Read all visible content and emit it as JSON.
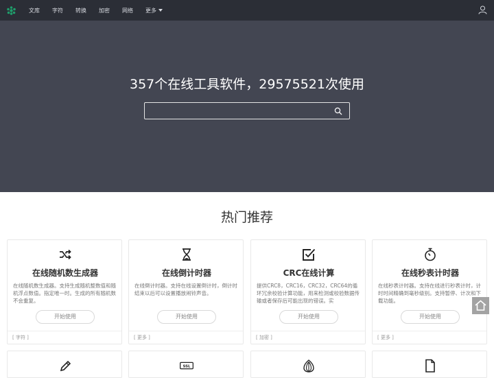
{
  "nav": {
    "items": [
      {
        "label": "文库"
      },
      {
        "label": "字符"
      },
      {
        "label": "转换"
      },
      {
        "label": "加密"
      },
      {
        "label": "网络"
      },
      {
        "label": "更多"
      }
    ]
  },
  "hero": {
    "title": "357个在线工具软件，29575521次使用",
    "search": {
      "value": "",
      "placeholder": ""
    }
  },
  "section": {
    "title": "热门推荐"
  },
  "cards": [
    {
      "icon": "shuffle-icon",
      "title": "在线随机数生成器",
      "desc": "在线随机数生成器。支持生成随机整数值和随机浮点数值。指定唯一时。生成的所有随机数不会重复。",
      "button": "开始使用",
      "tag": "[ 字符 ]"
    },
    {
      "icon": "hourglass-icon",
      "title": "在线倒计时器",
      "desc": "在线倒计时器。支持在线设置倒计时，倒计时结束以后可以设置播放闹铃声音。",
      "button": "开始使用",
      "tag": "[ 更多 ]"
    },
    {
      "icon": "checkbox-icon",
      "title": "CRC在线计算",
      "desc": "提供CRC8，CRC16，CRC32，CRC64的循环冗余校验计算功能，用来检测或校验数据传输或者保存后可能出现的错误。实",
      "button": "开始使用",
      "tag": "[ 加密 ]"
    },
    {
      "icon": "stopwatch-icon",
      "title": "在线秒表计时器",
      "desc": "在线秒表计时器。支持在线进行秒表计时，计时时间精确到毫秒级别。支持暂停、计次和下载功能。",
      "button": "开始使用",
      "tag": "[ 更多 ]"
    }
  ],
  "cards_row2": [
    {
      "icon": "pen-icon"
    },
    {
      "icon": "ssl-icon",
      "label": "SSL"
    },
    {
      "icon": "onion-icon"
    },
    {
      "icon": "document-icon"
    }
  ],
  "colors": {
    "nav_bg": "#2b2e36",
    "hero_bg": "#434652",
    "logo": "#1f9e6b",
    "float_btn": "#a3a3a3"
  }
}
